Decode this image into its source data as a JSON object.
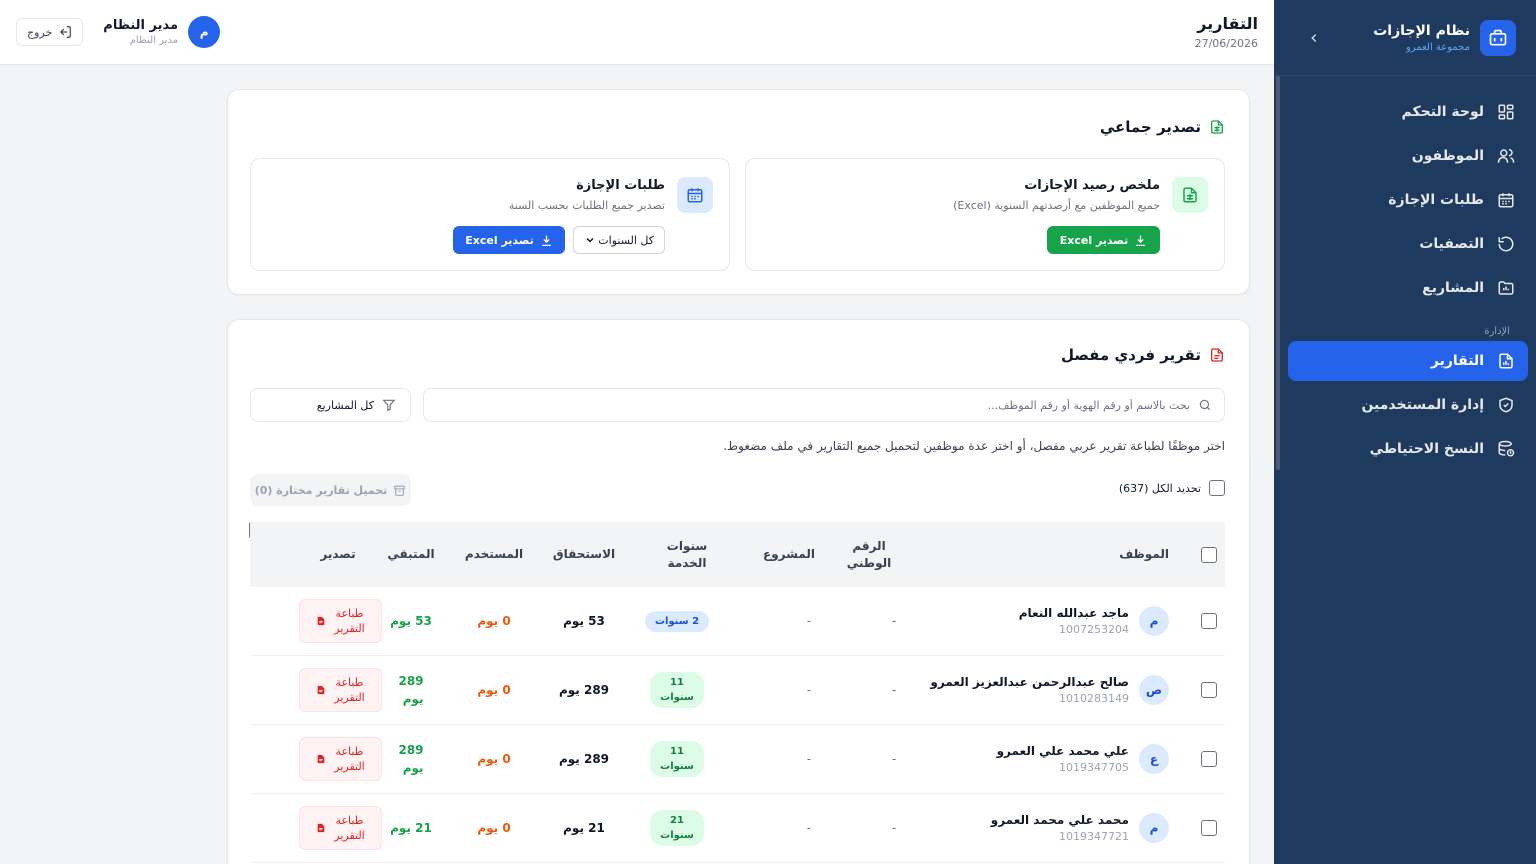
{
  "sidebar": {
    "title": "نظام الإجازات",
    "subtitle": "مجموعة العمرو",
    "items": [
      {
        "label": "لوحة التحكم",
        "icon": "dashboard-icon"
      },
      {
        "label": "الموظفون",
        "icon": "users-icon"
      },
      {
        "label": "طلبات الإجازة",
        "icon": "calendar-icon"
      },
      {
        "label": "التصفيات",
        "icon": "refresh-icon"
      },
      {
        "label": "المشاريع",
        "icon": "folder-icon"
      }
    ],
    "section_label": "الإدارة",
    "admin_items": [
      {
        "label": "التقارير",
        "icon": "report-icon",
        "active": true
      },
      {
        "label": "إدارة المستخدمين",
        "icon": "shield-icon"
      },
      {
        "label": "النسخ الاحتياطي",
        "icon": "database-icon"
      }
    ]
  },
  "header": {
    "title": "التقارير",
    "date": "27/06/2026",
    "user_initial": "م",
    "user_name": "مدير النظام",
    "user_role": "مدير النظام",
    "logout_label": "خروج"
  },
  "bulk": {
    "title": "تصدير جماعي",
    "summary": {
      "title": "ملخص رصيد الإجازات",
      "desc": "جميع الموظفين مع أرصدتهم السنوية (Excel)",
      "button": "تصدير Excel"
    },
    "requests": {
      "title": "طلبات الإجازة",
      "desc": "تصدير جميع الطلبات بحسب السنة",
      "select_value": "كل السنوات",
      "button": "تصدير Excel"
    }
  },
  "individual": {
    "title": "تقرير فردي مفصل",
    "search_placeholder": "بحث بالاسم أو رقم الهوية أو رقم الموظف...",
    "filter_label": "كل المشاريع",
    "hint": "اختر موظفًا لطباعة تقرير عربي مفصل، أو اختر عدة موظفين لتحميل جميع التقارير في ملف مضغوط.",
    "select_all": "تحديد الكل (637)",
    "download_selected": "تحميل تقارير مختارة (0)"
  },
  "table": {
    "headers": {
      "employee": "الموظف",
      "national_id_1": "الرقم",
      "national_id_2": "الوطني",
      "project": "المشروع",
      "service_1": "سنوات",
      "service_2": "الخدمة",
      "entitlement": "الاستحقاق",
      "used": "المستخدم",
      "remaining": "المتبقي",
      "export": "تصدير"
    },
    "rows": [
      {
        "initial": "م",
        "name": "ماجد عبدالله النعام",
        "emp_id": "1007253204",
        "national": "-",
        "project": "-",
        "service": "2 سنوات",
        "service_l1": "",
        "service_l2": "",
        "entitlement": "53 يوم",
        "used": "0 يوم",
        "remaining_1": "53 يوم",
        "remaining_2": "",
        "print_1": "طباعة",
        "print_2": "التقرير"
      },
      {
        "initial": "ص",
        "name": "صالح عبدالرحمن عبدالعزيز العمرو",
        "emp_id": "1010283149",
        "national": "-",
        "project": "-",
        "service": "",
        "service_l1": "11",
        "service_l2": "سنوات",
        "entitlement": "289 يوم",
        "used": "0 يوم",
        "remaining_1": "289",
        "remaining_2": "يوم",
        "print_1": "طباعة",
        "print_2": "التقرير"
      },
      {
        "initial": "ع",
        "name": "علي محمد علي العمرو",
        "emp_id": "1019347705",
        "national": "-",
        "project": "-",
        "service": "",
        "service_l1": "11",
        "service_l2": "سنوات",
        "entitlement": "289 يوم",
        "used": "0 يوم",
        "remaining_1": "289",
        "remaining_2": "يوم",
        "print_1": "طباعة",
        "print_2": "التقرير"
      },
      {
        "initial": "م",
        "name": "محمد علي محمد العمرو",
        "emp_id": "1019347721",
        "national": "-",
        "project": "-",
        "service": "",
        "service_l1": "21",
        "service_l2": "سنوات",
        "entitlement": "21 يوم",
        "used": "0 يوم",
        "remaining_1": "21 يوم",
        "remaining_2": "",
        "print_1": "طباعة",
        "print_2": "التقرير"
      }
    ]
  },
  "colors": {
    "sidebar_bg": "#1e3a5f",
    "accent": "#2563eb",
    "success": "#16a34a",
    "danger": "#dc2626",
    "warning": "#ea580c"
  }
}
